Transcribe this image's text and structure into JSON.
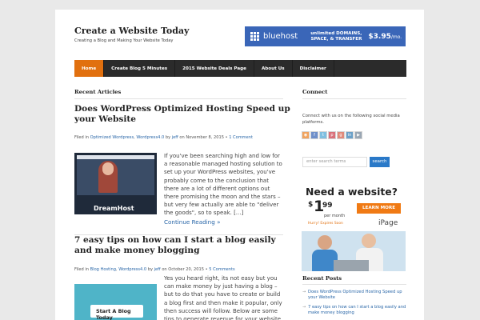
{
  "site": {
    "title": "Create a Website Today",
    "description": "Creating a Blog and Making Your Website Today"
  },
  "banner": {
    "brand": "bluehost",
    "tag_line1": "unlimited DOMAINS,",
    "tag_line2": "SPACE, & TRANSFER",
    "price": "$3.95",
    "price_unit": "/mo.",
    "color": "#3a66b8"
  },
  "nav": {
    "items": [
      {
        "label": "Home",
        "active": true
      },
      {
        "label": "Create Blog 5 Minutes"
      },
      {
        "label": "2015 Website Deals Page"
      },
      {
        "label": "About Us"
      },
      {
        "label": "Disclaimer"
      }
    ],
    "accent": "#e1700f"
  },
  "main": {
    "heading": "Recent Articles",
    "posts": [
      {
        "title": "Does WordPress Optimized Hosting Speed up your Website",
        "meta_filed": "Filed in",
        "cat1": "Optimized Wordpress",
        "comma": ",",
        "cat2": "Wordpress4.0",
        "by": "by",
        "author": "jeff",
        "on": "on November 8, 2015 •",
        "comments": "1 Comment",
        "excerpt": "If you've been searching high and low for a reasonable managed hosting solution to set up your WordPress websites, you've probably come to the conclusion that there are a lot of different options out there promising the moon and the stars – but very few actually are able to \"deliver the goods\", so to speak. [...]",
        "continue": "Continue Reading »",
        "thumb_label": "DreamHost"
      },
      {
        "title": "7 easy tips on how can I start a blog easily and make money blogging",
        "meta_filed": "Filed in",
        "cat1": "Blog Hosting",
        "comma": ",",
        "cat2": "Wordpress4.0",
        "by": "by",
        "author": "jeff",
        "on": "on October 20, 2015 •",
        "comments": "5 Comments",
        "excerpt": "Yes you heard right, its not easy but you can make money by just having a blog – but to do that you have to create or build a blog first and then make it popular, only then success will follow. Below are some tips to generate revenue for your website",
        "thumb_label": "Start A Blog Today"
      }
    ]
  },
  "sidebar": {
    "connect_heading": "Connect",
    "connect_text": "Connect with us on the following social media platforms.",
    "social_icons": [
      "rss-icon",
      "facebook-icon",
      "twitter-icon",
      "pinterest-icon",
      "google-plus-icon",
      "linkedin-icon",
      "youtube-icon"
    ],
    "search_placeholder": "enter search terms",
    "search_button": "search",
    "ad": {
      "headline": "Need a website?",
      "dollar": "$",
      "price_whole": "1",
      "price_cents": "99",
      "per_month": "per month",
      "hurry": "Hurry! Expires Soon",
      "button": "LEARN MORE",
      "brand": "iPage"
    },
    "recent_heading": "Recent Posts",
    "recent_posts": [
      "Does WordPress Optimized Hosting Speed up your Website",
      "7 easy tips on how can I start a blog easily and make money blogging"
    ]
  }
}
